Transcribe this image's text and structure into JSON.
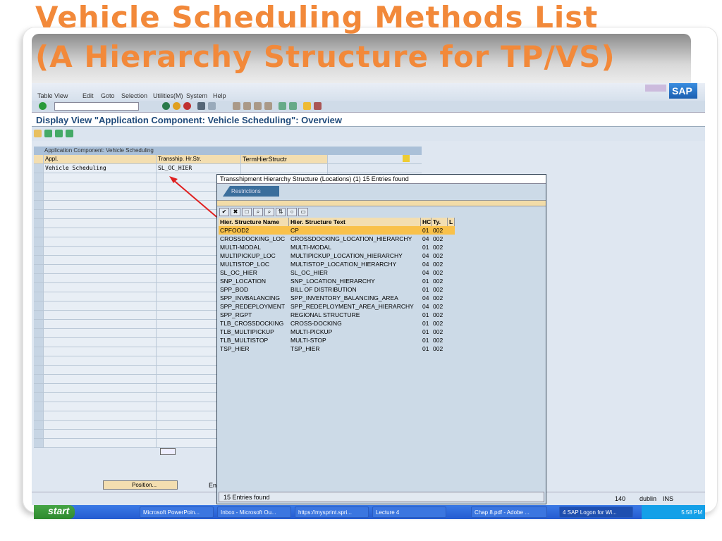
{
  "slide": {
    "title_line1": "Vehicle Scheduling Methods List",
    "title_line2": "(A Hierarchy Structure for TP/VS)"
  },
  "menu": [
    "Table View",
    "Edit",
    "Goto",
    "Selection",
    "Utilities(M)",
    "System",
    "Help"
  ],
  "view_title": "Display View \"Application Component: Vehicle Scheduling\": Overview",
  "table": {
    "caption": "Application Component: Vehicle Scheduling",
    "headers": [
      "Appl.",
      "Transship. Hr.Str.",
      "TermHierStructr"
    ],
    "rows": [
      [
        "Vehicle Scheduling",
        "SL_OC_HIER",
        ""
      ]
    ]
  },
  "position_button": "Position...",
  "entry_label": "En",
  "popup": {
    "title": "Transshipment Hierarchy Structure (Locations) (1)   15 Entries found",
    "tab": "Restrictions",
    "headers": [
      "Hier. Structure Name",
      "Hier. Structure Text",
      "HC",
      "Ty.",
      "L"
    ],
    "rows": [
      [
        "CPFOOD2",
        "CP",
        "01",
        "002"
      ],
      [
        "CROSSDOCKING_LOC",
        "CROSSDOCKING_LOCATION_HIERARCHY",
        "04",
        "002"
      ],
      [
        "MULTI-MODAL",
        "MULTI-MODAL",
        "01",
        "002"
      ],
      [
        "MULTIPICKUP_LOC",
        "MULTIPICKUP_LOCATION_HIERARCHY",
        "04",
        "002"
      ],
      [
        "MULTISTOP_LOC",
        "MULTISTOP_LOCATION_HIERARCHY",
        "04",
        "002"
      ],
      [
        "SL_OC_HIER",
        "SL_OC_HIER",
        "04",
        "002"
      ],
      [
        "SNP_LOCATION",
        "SNP_LOCATION_HIERARCHY",
        "01",
        "002"
      ],
      [
        "SPP_BOD",
        "BILL OF DISTRIBUTION",
        "01",
        "002"
      ],
      [
        "SPP_INVBALANCING",
        "SPP_INVENTORY_BALANCING_AREA",
        "04",
        "002"
      ],
      [
        "SPP_REDEPLOYMENT",
        "SPP_REDEPLOYMENT_AREA_HIERARCHY",
        "04",
        "002"
      ],
      [
        "SPP_RGPT",
        "REGIONAL STRUCTURE",
        "01",
        "002"
      ],
      [
        "TLB_CROSSDOCKING",
        "CROSS-DOCKING",
        "01",
        "002"
      ],
      [
        "TLB_MULTIPICKUP",
        "MULTI-PICKUP",
        "01",
        "002"
      ],
      [
        "TLB_MULTISTOP",
        "MULTI-STOP",
        "01",
        "002"
      ],
      [
        "TSP_HIER",
        "TSP_HIER",
        "01",
        "002"
      ]
    ],
    "status": "15 Entries found"
  },
  "status": {
    "num": "140",
    "server": "dublin",
    "mode": "INS"
  },
  "taskbar": {
    "start": "start",
    "items": [
      "Microsoft PowerPoin...",
      "Inbox - Microsoft Ou...",
      "https://mysprint.spri...",
      "Lecture 4",
      "Chap 8.pdf - Adobe ...",
      "4 SAP Logon for Wi..."
    ],
    "clock": "5:58 PM"
  },
  "colors": {
    "title": "#f2893a",
    "sap_blue": "#1f4a7a",
    "selected": "#f9c14a"
  }
}
